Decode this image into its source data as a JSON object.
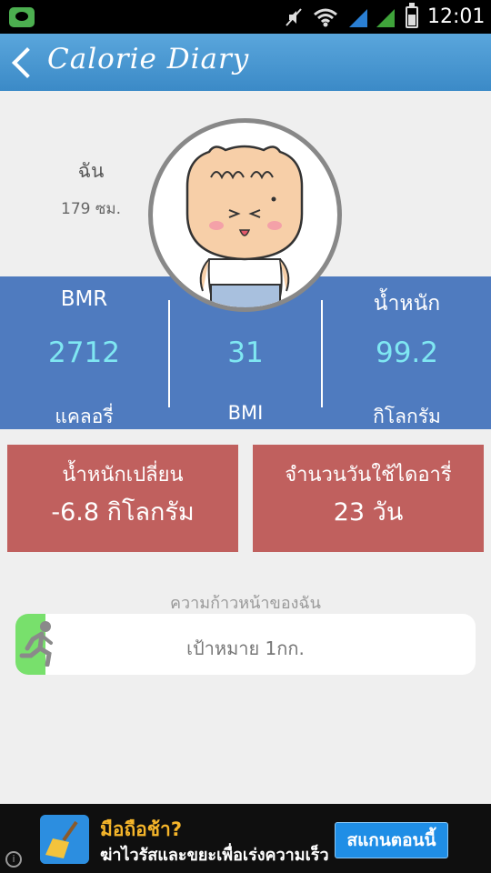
{
  "status_bar": {
    "time": "12:01"
  },
  "header": {
    "title": "Calorie Diary"
  },
  "profile": {
    "name": "ฉัน",
    "height": "179 ซม."
  },
  "stats": {
    "bmr": {
      "label": "BMR",
      "value": "2712",
      "unit": "แคลอรี่"
    },
    "bmi": {
      "value": "31",
      "unit": "BMI"
    },
    "weight": {
      "label": "น้ำหนัก",
      "value": "99.2",
      "unit": "กิโลกรัม"
    }
  },
  "cards": {
    "weight_change": {
      "title": "น้ำหนักเปลี่ยน",
      "value": "-6.8 กิโลกรัม"
    },
    "days_used": {
      "title": "จำนวนวันใช้ไดอารี่",
      "value": "23 วัน"
    }
  },
  "progress": {
    "label": "ความก้าวหน้าของฉัน",
    "goal_text": "เป้าหมาย 1กก.",
    "fill_fraction": 0.065,
    "fill_color": "#78e06c"
  },
  "ad": {
    "headline": "มือถือช้า?",
    "subline": "ฆ่าไวรัสและขยะเพื่อเร่งความเร็ว",
    "button_label": "สแกนตอนนี้"
  },
  "colors": {
    "header": "#4a98d2",
    "stats_band": "#4f7bbf",
    "stat_value": "#7fe7f2",
    "card": "#c0605e"
  },
  "icons": [
    "line-app-icon",
    "mute-icon",
    "wifi-icon",
    "signal-icon",
    "battery-icon",
    "back-arrow-icon",
    "avatar-cat",
    "runner-icon",
    "broom-icon",
    "info-icon"
  ]
}
